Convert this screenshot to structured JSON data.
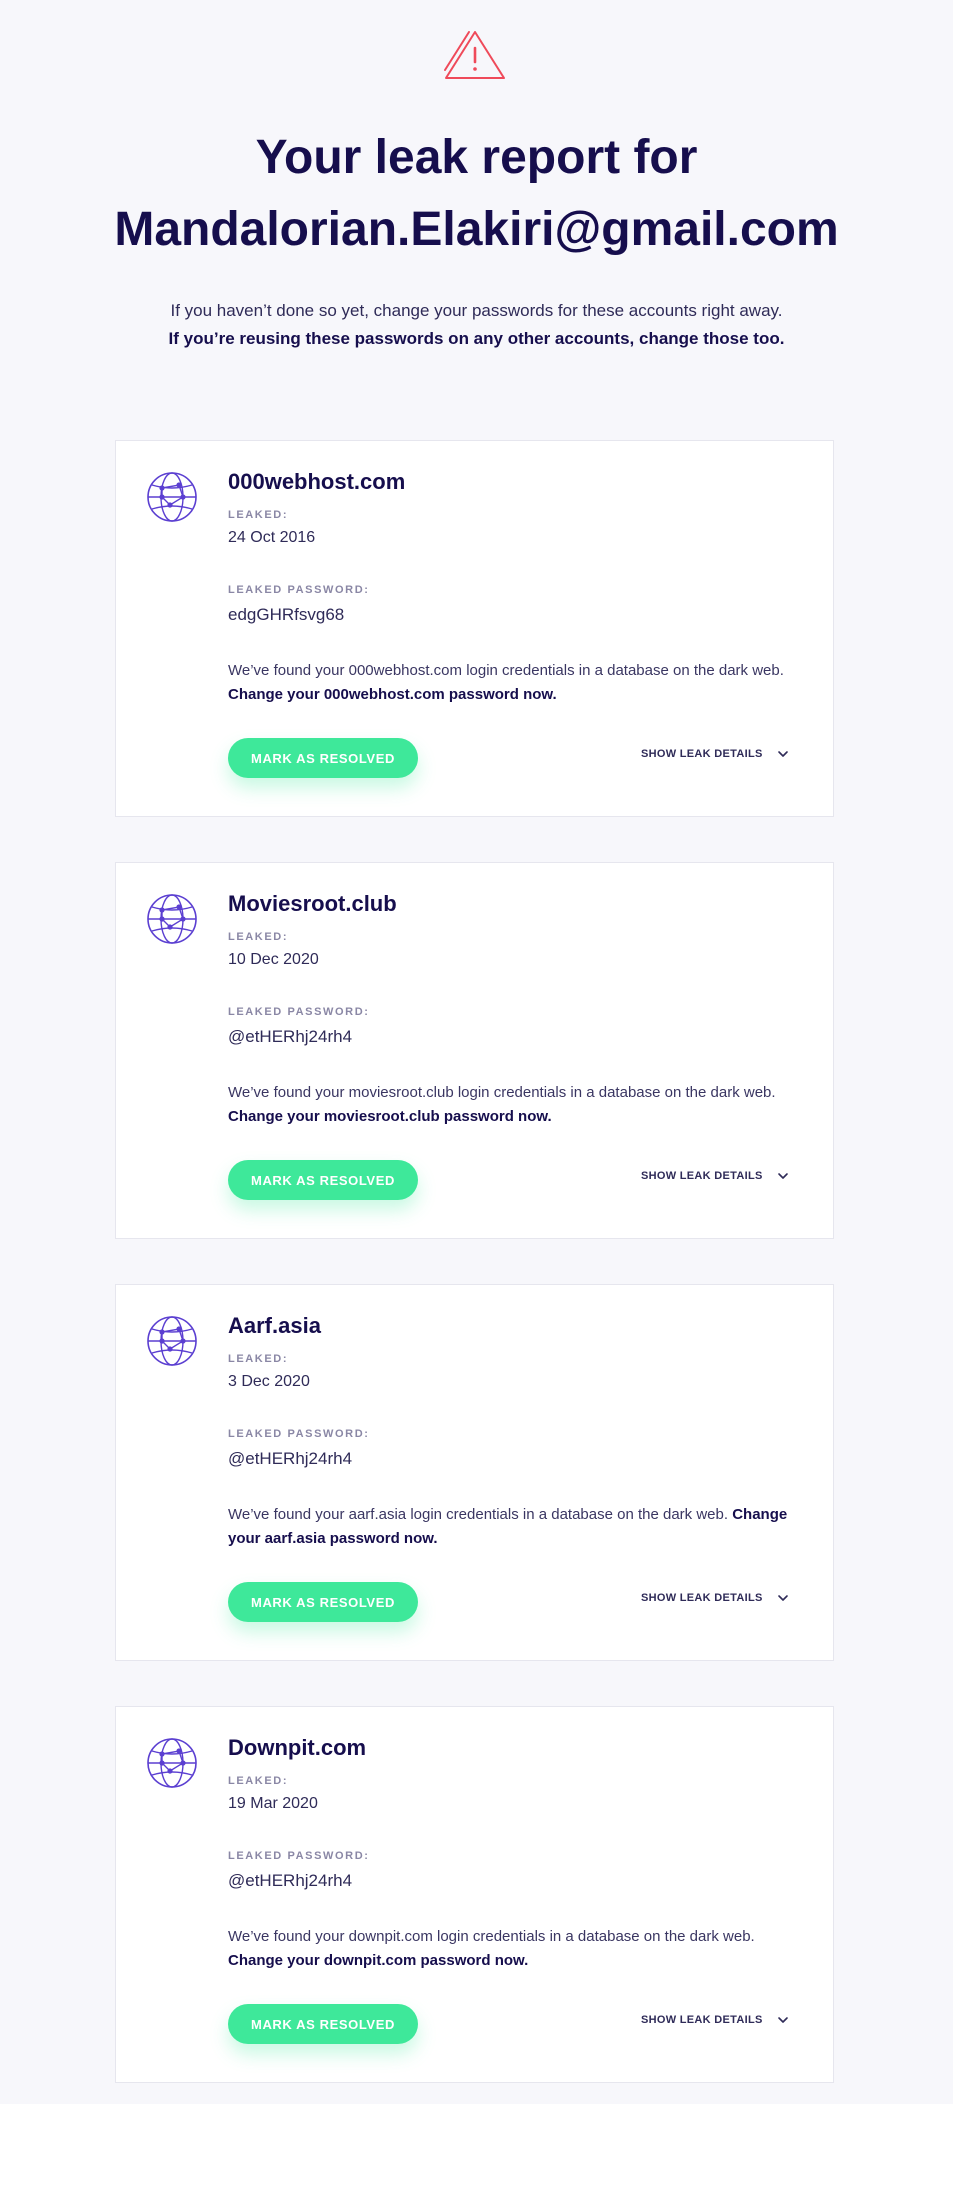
{
  "header": {
    "icon": "warning-triangle-icon",
    "title_line1": "Your leak report for",
    "title_line2": "Mandalorian.Elakiri@gmail.com",
    "intro_line1": "If you haven’t done so yet, change your passwords for these accounts right away.",
    "intro_line2": "If you’re reusing these passwords on any other accounts, change those too."
  },
  "colors": {
    "accent_green": "#3ee89a",
    "navy_text": "#160e4d",
    "globe_purple": "#5b3fd1",
    "warning_red": "#ef4a5a"
  },
  "leaks": [
    {
      "icon": "globe-icon",
      "site": "000webhost.com",
      "leaked_label": "LEAKED:",
      "leaked_date": "24 Oct 2016",
      "password_label": "LEAKED PASSWORD:",
      "password": "edgGHRfsvg68",
      "desc": "We’ve found your 000webhost.com login credentials in a database on the dark web.",
      "cta": "Change your 000webhost.com password now.",
      "resolve_label": "MARK AS RESOLVED",
      "details_label": "SHOW LEAK DETAILS"
    },
    {
      "icon": "globe-icon",
      "site": "Moviesroot.club",
      "leaked_label": "LEAKED:",
      "leaked_date": "10 Dec 2020",
      "password_label": "LEAKED PASSWORD:",
      "password": "@etHERhj24rh4",
      "desc": "We’ve found your moviesroot.club login credentials in a database on the dark web.",
      "cta": "Change your moviesroot.club password now.",
      "resolve_label": "MARK AS RESOLVED",
      "details_label": "SHOW LEAK DETAILS"
    },
    {
      "icon": "globe-icon",
      "site": "Aarf.asia",
      "leaked_label": "LEAKED:",
      "leaked_date": "3 Dec 2020",
      "password_label": "LEAKED PASSWORD:",
      "password": "@etHERhj24rh4",
      "desc": "We’ve found your aarf.asia login credentials in a database on the dark web.",
      "cta": "Change your aarf.asia password now.",
      "resolve_label": "MARK AS RESOLVED",
      "details_label": "SHOW LEAK DETAILS"
    },
    {
      "icon": "globe-icon",
      "site": "Downpit.com",
      "leaked_label": "LEAKED:",
      "leaked_date": "19 Mar 2020",
      "password_label": "LEAKED PASSWORD:",
      "password": "@etHERhj24rh4",
      "desc": "We’ve found your downpit.com login credentials in a database on the dark web.",
      "cta": "Change your downpit.com password now.",
      "resolve_label": "MARK AS RESOLVED",
      "details_label": "SHOW LEAK DETAILS"
    }
  ]
}
